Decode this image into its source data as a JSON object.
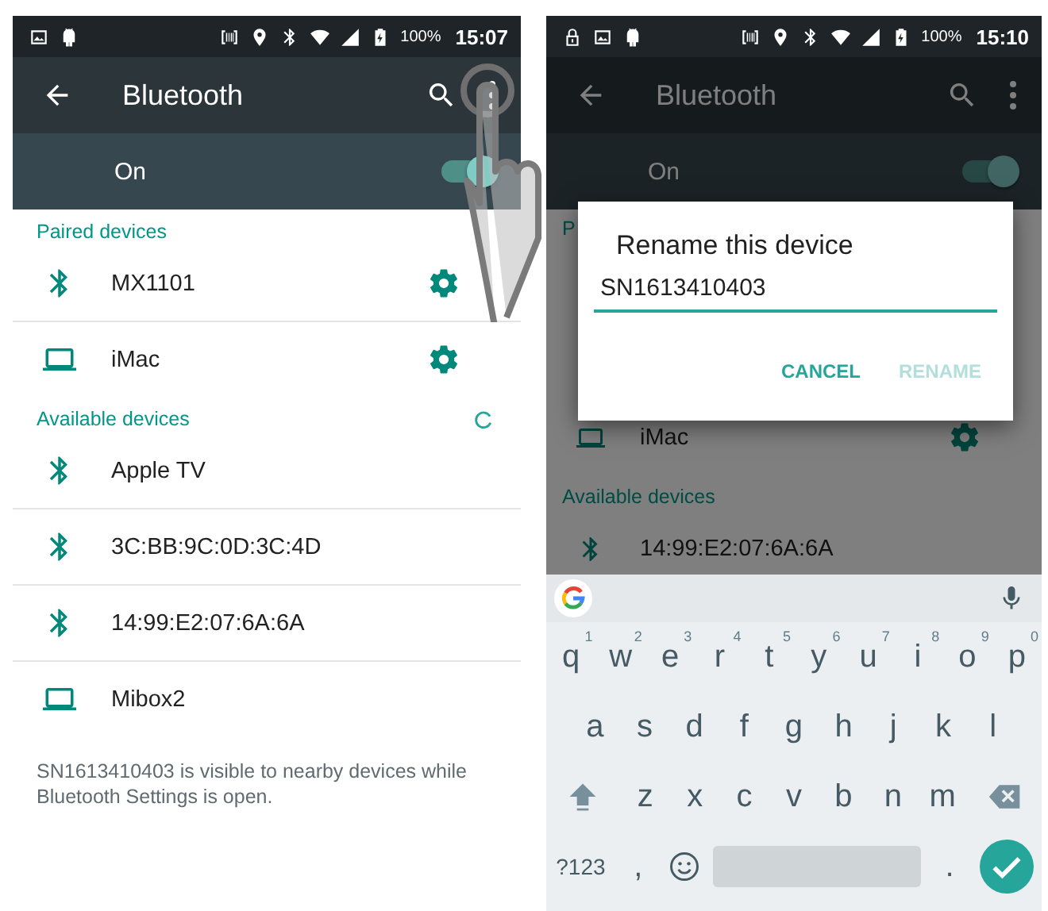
{
  "screens": [
    {
      "status_bar": {
        "battery": "100%",
        "time": "15:07"
      },
      "app_bar": {
        "title": "Bluetooth"
      },
      "master_switch": {
        "label": "On",
        "on": true
      },
      "sections": [
        {
          "title": "Paired devices",
          "devices": [
            {
              "name": "MX1101",
              "kind": "bluetooth",
              "settings": true
            },
            {
              "name": "iMac",
              "kind": "laptop",
              "settings": true
            }
          ]
        },
        {
          "title": "Available devices",
          "scanning": true,
          "devices": [
            {
              "name": "Apple TV",
              "kind": "bluetooth"
            },
            {
              "name": "3C:BB:9C:0D:3C:4D",
              "kind": "bluetooth"
            },
            {
              "name": "14:99:E2:07:6A:6A",
              "kind": "bluetooth"
            },
            {
              "name": "Mibox2",
              "kind": "laptop"
            }
          ]
        }
      ],
      "footer": "SN1613410403 is visible to nearby devices while Bluetooth Settings is open.",
      "touch_hint": true
    },
    {
      "status_bar": {
        "locked": true,
        "battery": "100%",
        "time": "15:10"
      },
      "app_bar": {
        "title": "Bluetooth"
      },
      "master_switch": {
        "label": "On",
        "on": true
      },
      "sections": [
        {
          "title": "P",
          "devices": [
            {
              "name": "iMac",
              "kind": "laptop",
              "settings": true
            }
          ]
        },
        {
          "title": "Available devices",
          "devices": [
            {
              "name": "14:99:E2:07:6A:6A",
              "kind": "bluetooth"
            }
          ]
        }
      ],
      "dialog": {
        "title": "Rename this device",
        "value": "SN1613410403",
        "buttons": [
          {
            "label": "CANCEL",
            "disabled": false
          },
          {
            "label": "RENAME",
            "disabled": true
          }
        ]
      },
      "keyboard": {
        "key_rows": [
          {
            "keys": [
              {
                "kind": "letter",
                "label": "q",
                "hint": "1"
              },
              {
                "kind": "letter",
                "label": "w",
                "hint": "2"
              },
              {
                "kind": "letter",
                "label": "e",
                "hint": "3"
              },
              {
                "kind": "letter",
                "label": "r",
                "hint": "4"
              },
              {
                "kind": "letter",
                "label": "t",
                "hint": "5"
              },
              {
                "kind": "letter",
                "label": "y",
                "hint": "6"
              },
              {
                "kind": "letter",
                "label": "u",
                "hint": "7"
              },
              {
                "kind": "letter",
                "label": "i",
                "hint": "8"
              },
              {
                "kind": "letter",
                "label": "o",
                "hint": "9"
              },
              {
                "kind": "letter",
                "label": "p",
                "hint": "0"
              }
            ]
          },
          {
            "keys": [
              {
                "kind": "letter",
                "label": "a"
              },
              {
                "kind": "letter",
                "label": "s"
              },
              {
                "kind": "letter",
                "label": "d"
              },
              {
                "kind": "letter",
                "label": "f"
              },
              {
                "kind": "letter",
                "label": "g"
              },
              {
                "kind": "letter",
                "label": "h"
              },
              {
                "kind": "letter",
                "label": "j"
              },
              {
                "kind": "letter",
                "label": "k"
              },
              {
                "kind": "letter",
                "label": "l"
              }
            ]
          },
          {
            "keys": [
              {
                "kind": "shift"
              },
              {
                "kind": "letter",
                "label": "z"
              },
              {
                "kind": "letter",
                "label": "x"
              },
              {
                "kind": "letter",
                "label": "c"
              },
              {
                "kind": "letter",
                "label": "v"
              },
              {
                "kind": "letter",
                "label": "b"
              },
              {
                "kind": "letter",
                "label": "n"
              },
              {
                "kind": "letter",
                "label": "m"
              },
              {
                "kind": "backspace"
              }
            ]
          },
          {
            "keys": [
              {
                "kind": "symbols",
                "label": "?123"
              },
              {
                "kind": "letter",
                "label": ","
              },
              {
                "kind": "emoji"
              },
              {
                "kind": "space"
              },
              {
                "kind": "letter",
                "label": "."
              },
              {
                "kind": "enter"
              }
            ]
          }
        ]
      }
    }
  ]
}
